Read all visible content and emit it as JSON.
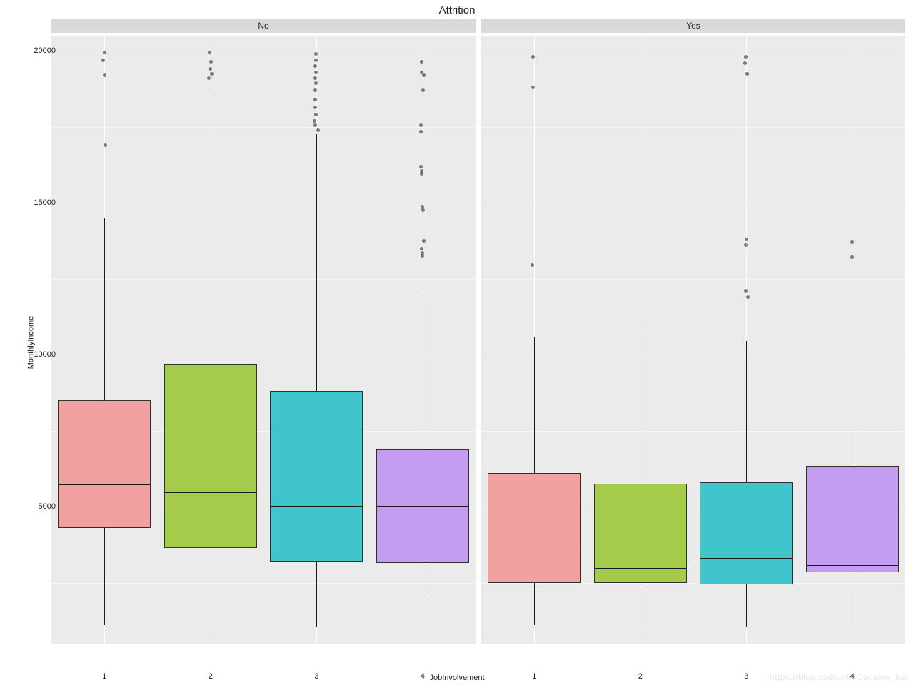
{
  "chart_data": {
    "type": "boxplot",
    "title": "Attrition",
    "xlabel": "JobInvolvement",
    "ylabel": "MonthlyIncome",
    "ylim": [
      500,
      20500
    ],
    "facets": [
      "No",
      "Yes"
    ],
    "categories": [
      "1",
      "2",
      "3",
      "4"
    ],
    "fill_colors": {
      "1": "#f3a0a0",
      "2": "#a4cc4a",
      "3": "#3fc5cb",
      "4": "#c49cf0"
    },
    "y_breaks": [
      5000,
      10000,
      15000,
      20000
    ],
    "y_minor": [
      2500,
      7500,
      12500,
      17500
    ],
    "series": [
      {
        "facet": "No",
        "x": "1",
        "lower_whisker": 1100,
        "q1": 4300,
        "median": 5750,
        "q3": 8500,
        "upper_whisker": 14500,
        "outliers": [
          16900,
          19200,
          19700,
          19950
        ]
      },
      {
        "facet": "No",
        "x": "2",
        "lower_whisker": 1100,
        "q1": 3650,
        "median": 5500,
        "q3": 9700,
        "upper_whisker": 18800,
        "outliers": [
          19100,
          19250,
          19400,
          19650,
          19950
        ]
      },
      {
        "facet": "No",
        "x": "3",
        "lower_whisker": 1050,
        "q1": 3200,
        "median": 5050,
        "q3": 8800,
        "upper_whisker": 17250,
        "outliers": [
          17400,
          17550,
          17700,
          17900,
          18150,
          18400,
          18700,
          18950,
          19100,
          19300,
          19500,
          19700,
          19900
        ]
      },
      {
        "facet": "No",
        "x": "4",
        "lower_whisker": 2100,
        "q1": 3150,
        "median": 5050,
        "q3": 6900,
        "upper_whisker": 12000,
        "outliers": [
          13250,
          13350,
          13500,
          13750,
          14750,
          14850,
          15950,
          16050,
          16200,
          17350,
          17550,
          18700,
          19200,
          19300,
          19650
        ]
      },
      {
        "facet": "Yes",
        "x": "1",
        "lower_whisker": 1100,
        "q1": 2500,
        "median": 3800,
        "q3": 6100,
        "upper_whisker": 10600,
        "outliers": [
          12950,
          18800,
          19800
        ]
      },
      {
        "facet": "Yes",
        "x": "2",
        "lower_whisker": 1100,
        "q1": 2500,
        "median": 3000,
        "q3": 5750,
        "upper_whisker": 10850,
        "outliers": []
      },
      {
        "facet": "Yes",
        "x": "3",
        "lower_whisker": 1050,
        "q1": 2450,
        "median": 3350,
        "q3": 5800,
        "upper_whisker": 10450,
        "outliers": [
          11900,
          12100,
          13600,
          13800,
          19250,
          19600,
          19800
        ]
      },
      {
        "facet": "Yes",
        "x": "4",
        "lower_whisker": 1100,
        "q1": 2850,
        "median": 3100,
        "q3": 6350,
        "upper_whisker": 7500,
        "outliers": [
          13200,
          13700
        ]
      }
    ]
  },
  "watermark": "https://blog.csdn.net/Cocaine_bai"
}
